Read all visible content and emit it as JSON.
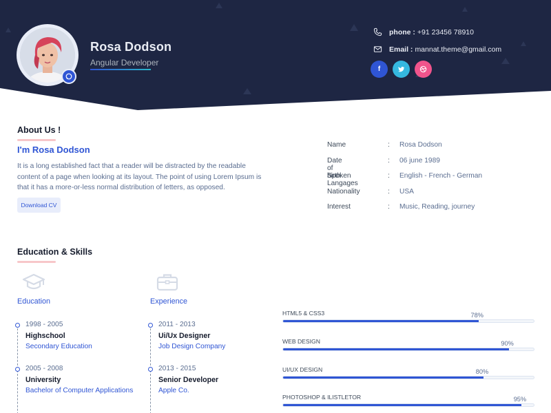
{
  "profile": {
    "name": "Rosa Dodson",
    "role": "Angular Developer"
  },
  "contact": {
    "phone_label": "phone :",
    "phone": "+91 23456 78910",
    "email_label": "Email :",
    "email": "mannat.theme@gmail.com"
  },
  "social": [
    {
      "icon": "facebook-icon",
      "glyph": "f",
      "color": "#2f55d4"
    },
    {
      "icon": "twitter-icon",
      "glyph": "t",
      "color": "#35b8e0"
    },
    {
      "icon": "dribbble-icon",
      "glyph": "◎",
      "color": "#f1548c"
    }
  ],
  "about": {
    "title": "About Us !",
    "subtitle": "I'm Rosa Dodson",
    "text": "It is a long established fact that a reader will be distracted by the readable content of a page when looking at its layout. The point of using Lorem Ipsum is that it has a more-or-less normal distribution of letters, as opposed.",
    "button": "Download CV"
  },
  "info": [
    {
      "key": "Name",
      "value": "Rosa Dodson"
    },
    {
      "key": "Date of birth",
      "value": "06 june 1989"
    },
    {
      "key": "Spoken Langages",
      "value": "English - French - German"
    },
    {
      "key": "Nationality",
      "value": "USA"
    },
    {
      "key": "Interest",
      "value": "Music, Reading, journey"
    }
  ],
  "separator": ":",
  "edu_skills": {
    "title": "Education & Skills",
    "education": {
      "heading": "Education",
      "icon": "graduation-cap-icon",
      "items": [
        {
          "years": "1998 - 2005",
          "title": "Highschool",
          "sub": "Secondary Education"
        },
        {
          "years": "2005 - 2008",
          "title": "University",
          "sub": "Bachelor of Computer Applications"
        }
      ]
    },
    "experience": {
      "heading": "Experience",
      "icon": "briefcase-icon",
      "items": [
        {
          "years": "2011 - 2013",
          "title": "Ui/Ux Designer",
          "sub": "Job Design Company"
        },
        {
          "years": "2013 - 2015",
          "title": "Senior Developer",
          "sub": "Apple Co."
        }
      ]
    },
    "skills": [
      {
        "name": "HTML5 & CSS3",
        "percent": 78,
        "label": "78%"
      },
      {
        "name": "WEB DESIGN",
        "percent": 90,
        "label": "90%"
      },
      {
        "name": "UI/UX DESIGN",
        "percent": 80,
        "label": "80%"
      },
      {
        "name": "PHOTOSHOP & ILISTLETOR",
        "percent": 95,
        "label": "95%"
      }
    ]
  },
  "colors": {
    "header_bg": "#1c2541",
    "accent": "#2f55d4",
    "underline": "#f7c6c9"
  }
}
